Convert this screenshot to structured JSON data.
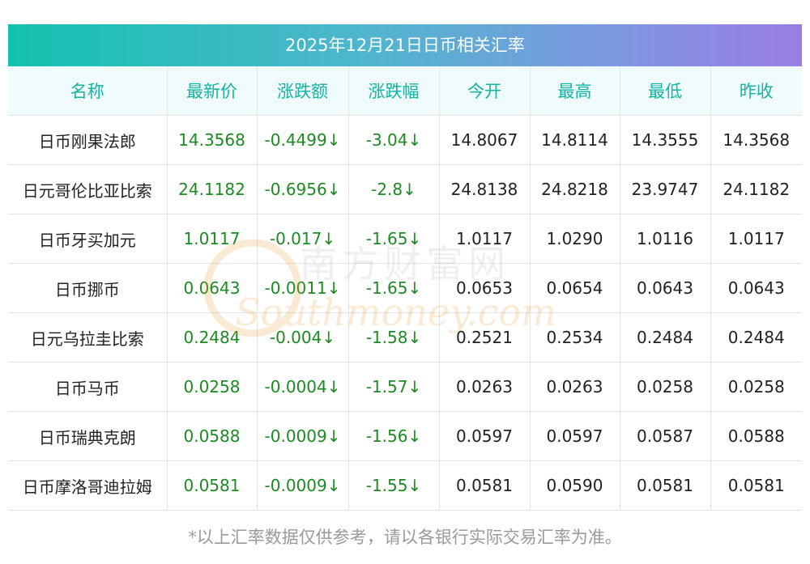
{
  "title": "2025年12月21日日币相关汇率",
  "headers": [
    "名称",
    "最新价",
    "涨跌额",
    "涨跌幅",
    "今开",
    "最高",
    "最低",
    "昨收"
  ],
  "rows": [
    {
      "name": "日币刚果法郎",
      "latest": "14.3568",
      "change": "-0.4499↓",
      "change_pct": "-3.04↓",
      "open": "14.8067",
      "high": "14.8114",
      "low": "14.3555",
      "prev_close": "14.3568"
    },
    {
      "name": "日元哥伦比亚比索",
      "latest": "24.1182",
      "change": "-0.6956↓",
      "change_pct": "-2.8↓",
      "open": "24.8138",
      "high": "24.8218",
      "low": "23.9747",
      "prev_close": "24.1182"
    },
    {
      "name": "日币牙买加元",
      "latest": "1.0117",
      "change": "-0.017↓",
      "change_pct": "-1.65↓",
      "open": "1.0117",
      "high": "1.0290",
      "low": "1.0116",
      "prev_close": "1.0117"
    },
    {
      "name": "日币挪币",
      "latest": "0.0643",
      "change": "-0.0011↓",
      "change_pct": "-1.65↓",
      "open": "0.0653",
      "high": "0.0654",
      "low": "0.0643",
      "prev_close": "0.0643"
    },
    {
      "name": "日元乌拉圭比索",
      "latest": "0.2484",
      "change": "-0.004↓",
      "change_pct": "-1.58↓",
      "open": "0.2521",
      "high": "0.2534",
      "low": "0.2484",
      "prev_close": "0.2484"
    },
    {
      "name": "日币马币",
      "latest": "0.0258",
      "change": "-0.0004↓",
      "change_pct": "-1.57↓",
      "open": "0.0263",
      "high": "0.0263",
      "low": "0.0258",
      "prev_close": "0.0258"
    },
    {
      "name": "日币瑞典克朗",
      "latest": "0.0588",
      "change": "-0.0009↓",
      "change_pct": "-1.56↓",
      "open": "0.0597",
      "high": "0.0597",
      "low": "0.0587",
      "prev_close": "0.0588"
    },
    {
      "name": "日币摩洛哥迪拉姆",
      "latest": "0.0581",
      "change": "-0.0009↓",
      "change_pct": "-1.55↓",
      "open": "0.0581",
      "high": "0.0590",
      "low": "0.0581",
      "prev_close": "0.0581"
    }
  ],
  "watermark": {
    "cn": "南方财富网",
    "en": "Southmoney.com"
  },
  "footnote": "*以上汇率数据仅供参考，请以各银行实际交易汇率为准。",
  "colors": {
    "accent": "#14b3a3",
    "positive_green": "#1d8a23",
    "watermark": "#f0a23c"
  }
}
